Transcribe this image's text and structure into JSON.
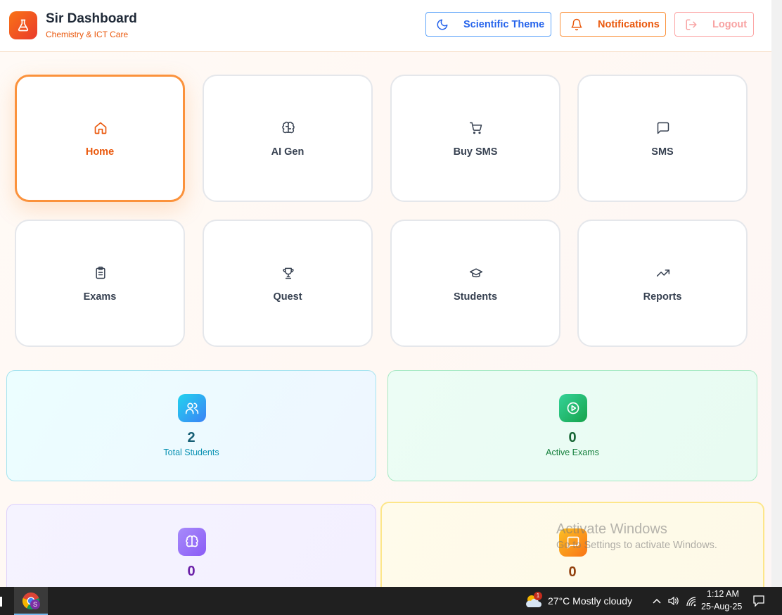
{
  "header": {
    "title": "Sir Dashboard",
    "subtitle": "Chemistry & ICT Care",
    "theme_label": "Scientific Theme",
    "notifications_label": "Notifications",
    "logout_label": "Logout"
  },
  "nav_tiles": [
    {
      "label": "Home",
      "icon": "home-icon",
      "active": true
    },
    {
      "label": "AI Gen",
      "icon": "brain-icon"
    },
    {
      "label": "Buy SMS",
      "icon": "cart-icon"
    },
    {
      "label": "SMS",
      "icon": "message-icon"
    },
    {
      "label": "Exams",
      "icon": "clipboard-icon"
    },
    {
      "label": "Quest",
      "icon": "trophy-icon"
    },
    {
      "label": "Students",
      "icon": "graduation-cap-icon"
    },
    {
      "label": "Reports",
      "icon": "trending-up-icon"
    }
  ],
  "stats": [
    {
      "value": "2",
      "label": "Total Students",
      "icon": "users-icon",
      "color": "#0891b2"
    },
    {
      "value": "0",
      "label": "Active Exams",
      "icon": "play-circle-icon",
      "color": "#15803d"
    },
    {
      "value": "0",
      "label": "",
      "icon": "brain-icon",
      "color": "#7e22ce"
    },
    {
      "value": "0",
      "label": "",
      "icon": "message-icon",
      "color": "#92400e"
    }
  ],
  "watermark": {
    "line1": "Activate Windows",
    "line2": "Go to Settings to activate Windows."
  },
  "taskbar": {
    "weather": "27°C  Mostly cloudy",
    "time": "1:12 AM",
    "date": "25-Aug-25",
    "badge_count": "1"
  },
  "colors": {
    "accent": "#f97316",
    "active_tile_border": "#fb923c"
  }
}
